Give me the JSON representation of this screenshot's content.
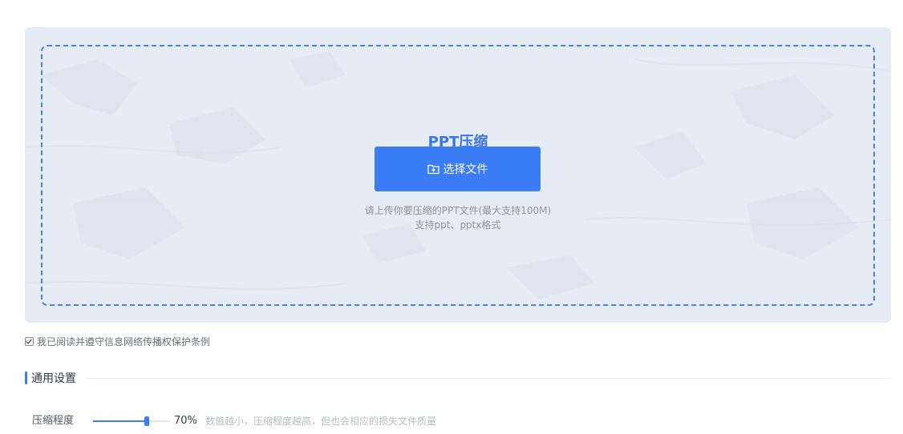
{
  "upload": {
    "title": "PPT压缩",
    "button_label": "选择文件",
    "button_icon": "folder-upload-icon",
    "hint_line1": "请上传你要压缩的PPT文件(最大支持100M)",
    "hint_line2": "支持ppt、pptx格式"
  },
  "agreement": {
    "checked": true,
    "label": "我已阅读并遵守信息网络传播权保护条例"
  },
  "settings": {
    "section_title": "通用设置",
    "compression": {
      "label": "压缩程度",
      "value": 70,
      "value_text": "70%",
      "hint": "数值越小，压缩程度越高，但也会相应的损失文件质量"
    }
  },
  "colors": {
    "accent": "#3b7cf7",
    "panel_bg": "#e6ecf5",
    "title": "#3a75ec"
  }
}
